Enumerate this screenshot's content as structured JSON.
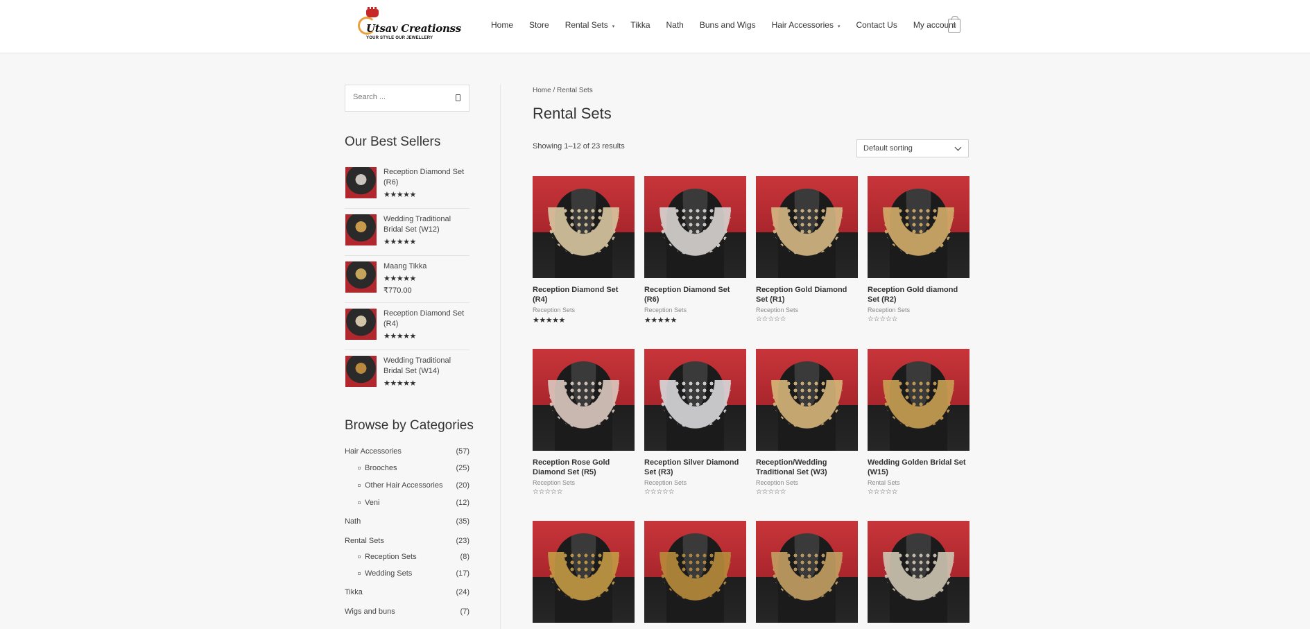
{
  "brand": {
    "name": "Utsav Creationss",
    "tagline": "YOUR STYLE OUR JEWELLERY"
  },
  "nav": {
    "items": [
      {
        "label": "Home",
        "has_dropdown": false
      },
      {
        "label": "Store",
        "has_dropdown": false
      },
      {
        "label": "Rental Sets",
        "has_dropdown": true
      },
      {
        "label": "Tikka",
        "has_dropdown": false
      },
      {
        "label": "Nath",
        "has_dropdown": false
      },
      {
        "label": "Buns and Wigs",
        "has_dropdown": false
      },
      {
        "label": "Hair Accessories",
        "has_dropdown": true
      },
      {
        "label": "Contact Us",
        "has_dropdown": false
      },
      {
        "label": "My account",
        "has_dropdown": false
      }
    ],
    "cart_count": "0"
  },
  "search": {
    "placeholder": "Search ..."
  },
  "best_sellers": {
    "heading": "Our Best Sellers",
    "items": [
      {
        "name": "Reception Diamond Set (R6)",
        "rating": 5,
        "price": ""
      },
      {
        "name": "Wedding Traditional Bridal Set (W12)",
        "rating": 5,
        "price": ""
      },
      {
        "name": "Maang Tikka",
        "rating": 5,
        "price": "₹770.00"
      },
      {
        "name": "Reception Diamond Set (R4)",
        "rating": 5,
        "price": ""
      },
      {
        "name": "Wedding Traditional Bridal Set (W14)",
        "rating": 5,
        "price": ""
      }
    ]
  },
  "categories": {
    "heading": "Browse by Categories",
    "items": [
      {
        "label": "Hair Accessories",
        "count": "(57)",
        "sub": false
      },
      {
        "label": "Brooches",
        "count": "(25)",
        "sub": true
      },
      {
        "label": "Other Hair Accessories",
        "count": "(20)",
        "sub": true
      },
      {
        "label": "Veni",
        "count": "(12)",
        "sub": true
      },
      {
        "label": "Nath",
        "count": "(35)",
        "sub": false
      },
      {
        "label": "Rental Sets",
        "count": "(23)",
        "sub": false
      },
      {
        "label": "Reception Sets",
        "count": "(8)",
        "sub": true
      },
      {
        "label": "Wedding Sets",
        "count": "(17)",
        "sub": true
      },
      {
        "label": "Tikka",
        "count": "(24)",
        "sub": false
      },
      {
        "label": "Wigs and buns",
        "count": "(7)",
        "sub": false
      }
    ]
  },
  "breadcrumb": "Home / Rental Sets",
  "page_title": "Rental Sets",
  "result_count": "Showing 1–12 of 23 results",
  "sorting": {
    "selected": "Default sorting"
  },
  "products": [
    {
      "name": "Reception Diamond Set (R4)",
      "category": "Reception Sets",
      "rating": 5,
      "necklace_color": "#d9c7a2"
    },
    {
      "name": "Reception Diamond Set (R6)",
      "category": "Reception Sets",
      "rating": 5,
      "necklace_color": "#d8d5d2"
    },
    {
      "name": "Reception Gold Diamond Set (R1)",
      "category": "Reception Sets",
      "rating": 0,
      "necklace_color": "#d6b985"
    },
    {
      "name": "Reception Gold diamond Set (R2)",
      "category": "Reception Sets",
      "rating": 0,
      "necklace_color": "#d3ad6a"
    },
    {
      "name": "Reception Rose Gold Diamond Set (R5)",
      "category": "Reception Sets",
      "rating": 0,
      "necklace_color": "#dcc9c0"
    },
    {
      "name": "Reception Silver Diamond Set (R3)",
      "category": "Reception Sets",
      "rating": 0,
      "necklace_color": "#d9d9dc"
    },
    {
      "name": "Reception/Wedding Traditional Set (W3)",
      "category": "Reception Sets",
      "rating": 0,
      "necklace_color": "#d7b77a"
    },
    {
      "name": "Wedding Golden Bridal Set (W15)",
      "category": "Rental Sets",
      "rating": 0,
      "necklace_color": "#c9a053"
    },
    {
      "name": "",
      "category": "",
      "rating": null,
      "necklace_color": "#c49a45"
    },
    {
      "name": "",
      "category": "",
      "rating": null,
      "necklace_color": "#b98b3c"
    },
    {
      "name": "",
      "category": "",
      "rating": null,
      "necklace_color": "#c4a062"
    },
    {
      "name": "",
      "category": "",
      "rating": null,
      "necklace_color": "#cfc6b3"
    }
  ]
}
